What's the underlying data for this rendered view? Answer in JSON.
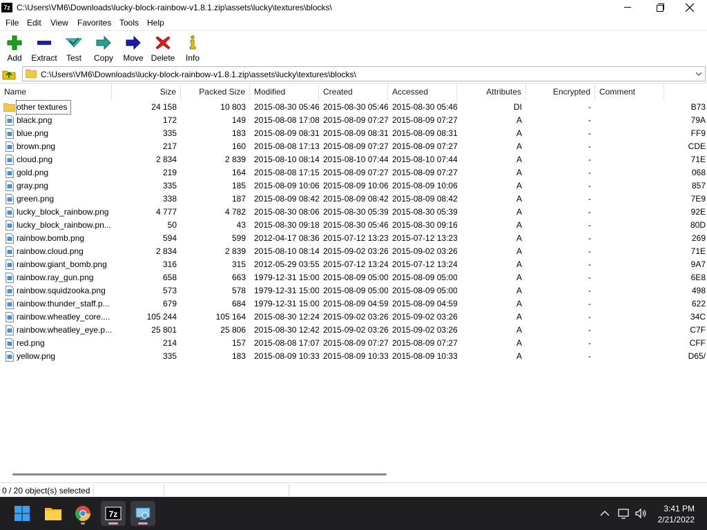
{
  "window": {
    "title": "C:\\Users\\VM6\\Downloads\\lucky-block-rainbow-v1.8.1.zip\\assets\\lucky\\textures\\blocks\\",
    "app_icon": "7z"
  },
  "menu": [
    "File",
    "Edit",
    "View",
    "Favorites",
    "Tools",
    "Help"
  ],
  "toolbar": {
    "add": "Add",
    "extract": "Extract",
    "test": "Test",
    "copy": "Copy",
    "move": "Move",
    "delete": "Delete",
    "info": "Info"
  },
  "address": {
    "path": "C:\\Users\\VM6\\Downloads\\lucky-block-rainbow-v1.8.1.zip\\assets\\lucky\\textures\\blocks\\"
  },
  "columns": {
    "name": "Name",
    "size": "Size",
    "packed": "Packed Size",
    "modified": "Modified",
    "created": "Created",
    "accessed": "Accessed",
    "attributes": "Attributes",
    "encrypted": "Encrypted",
    "comment": "Comment"
  },
  "rows": [
    {
      "name": "other textures",
      "size": "24 158",
      "packed": "10 803",
      "modified": "2015-08-30 05:46",
      "created": "2015-08-30 05:46",
      "accessed": "2015-08-30 05:46",
      "attr": "DI",
      "enc": "-",
      "crc": "B73"
    },
    {
      "name": "black.png",
      "size": "172",
      "packed": "149",
      "modified": "2015-08-08 17:08",
      "created": "2015-08-09 07:27",
      "accessed": "2015-08-09 07:27",
      "attr": "A",
      "enc": "-",
      "crc": "79A"
    },
    {
      "name": "blue.png",
      "size": "335",
      "packed": "183",
      "modified": "2015-08-09 08:31",
      "created": "2015-08-09 08:31",
      "accessed": "2015-08-09 08:31",
      "attr": "A",
      "enc": "-",
      "crc": "FF9"
    },
    {
      "name": "brown.png",
      "size": "217",
      "packed": "160",
      "modified": "2015-08-08 17:13",
      "created": "2015-08-09 07:27",
      "accessed": "2015-08-09 07:27",
      "attr": "A",
      "enc": "-",
      "crc": "CDE"
    },
    {
      "name": "cloud.png",
      "size": "2 834",
      "packed": "2 839",
      "modified": "2015-08-10 08:14",
      "created": "2015-08-10 07:44",
      "accessed": "2015-08-10 07:44",
      "attr": "A",
      "enc": "-",
      "crc": "71E"
    },
    {
      "name": "gold.png",
      "size": "219",
      "packed": "164",
      "modified": "2015-08-08 17:15",
      "created": "2015-08-09 07:27",
      "accessed": "2015-08-09 07:27",
      "attr": "A",
      "enc": "-",
      "crc": "068"
    },
    {
      "name": "gray.png",
      "size": "335",
      "packed": "185",
      "modified": "2015-08-09 10:06",
      "created": "2015-08-09 10:06",
      "accessed": "2015-08-09 10:06",
      "attr": "A",
      "enc": "-",
      "crc": "857"
    },
    {
      "name": "green.png",
      "size": "338",
      "packed": "187",
      "modified": "2015-08-09 08:42",
      "created": "2015-08-09 08:42",
      "accessed": "2015-08-09 08:42",
      "attr": "A",
      "enc": "-",
      "crc": "7E9"
    },
    {
      "name": "lucky_block_rainbow.png",
      "size": "4 777",
      "packed": "4 782",
      "modified": "2015-08-30 08:06",
      "created": "2015-08-30 05:39",
      "accessed": "2015-08-30 05:39",
      "attr": "A",
      "enc": "-",
      "crc": "92E"
    },
    {
      "name": "lucky_block_rainbow.pn...",
      "size": "50",
      "packed": "43",
      "modified": "2015-08-30 09:18",
      "created": "2015-08-30 05:46",
      "accessed": "2015-08-30 09:16",
      "attr": "A",
      "enc": "-",
      "crc": "80D"
    },
    {
      "name": "rainbow.bomb.png",
      "size": "594",
      "packed": "599",
      "modified": "2012-04-17 08:36",
      "created": "2015-07-12 13:23",
      "accessed": "2015-07-12 13:23",
      "attr": "A",
      "enc": "-",
      "crc": "269"
    },
    {
      "name": "rainbow.cloud.png",
      "size": "2 834",
      "packed": "2 839",
      "modified": "2015-08-10 08:14",
      "created": "2015-09-02 03:26",
      "accessed": "2015-09-02 03:26",
      "attr": "A",
      "enc": "-",
      "crc": "71E"
    },
    {
      "name": "rainbow.giant_bomb.png",
      "size": "316",
      "packed": "315",
      "modified": "2012-05-29 03:55",
      "created": "2015-07-12 13:24",
      "accessed": "2015-07-12 13:24",
      "attr": "A",
      "enc": "-",
      "crc": "9A7"
    },
    {
      "name": "rainbow.ray_gun.png",
      "size": "658",
      "packed": "663",
      "modified": "1979-12-31 15:00",
      "created": "2015-08-09 05:00",
      "accessed": "2015-08-09 05:00",
      "attr": "A",
      "enc": "-",
      "crc": "6E8"
    },
    {
      "name": "rainbow.squidzooka.png",
      "size": "573",
      "packed": "578",
      "modified": "1979-12-31 15:00",
      "created": "2015-08-09 05:00",
      "accessed": "2015-08-09 05:00",
      "attr": "A",
      "enc": "-",
      "crc": "498"
    },
    {
      "name": "rainbow.thunder_staff.p...",
      "size": "679",
      "packed": "684",
      "modified": "1979-12-31 15:00",
      "created": "2015-08-09 04:59",
      "accessed": "2015-08-09 04:59",
      "attr": "A",
      "enc": "-",
      "crc": "622"
    },
    {
      "name": "rainbow.wheatley_core....",
      "size": "105 244",
      "packed": "105 164",
      "modified": "2015-08-30 12:24",
      "created": "2015-09-02 03:26",
      "accessed": "2015-09-02 03:26",
      "attr": "A",
      "enc": "-",
      "crc": "34C"
    },
    {
      "name": "rainbow.wheatley_eye.p...",
      "size": "25 801",
      "packed": "25 806",
      "modified": "2015-08-30 12:42",
      "created": "2015-09-02 03:26",
      "accessed": "2015-09-02 03:26",
      "attr": "A",
      "enc": "-",
      "crc": "C7F"
    },
    {
      "name": "red.png",
      "size": "214",
      "packed": "157",
      "modified": "2015-08-08 17:07",
      "created": "2015-08-09 07:27",
      "accessed": "2015-08-09 07:27",
      "attr": "A",
      "enc": "-",
      "crc": "CFF"
    },
    {
      "name": "yellow.png",
      "size": "335",
      "packed": "183",
      "modified": "2015-08-09 10:33",
      "created": "2015-08-09 10:33",
      "accessed": "2015-08-09 10:33",
      "attr": "A",
      "enc": "-",
      "crc": "D65/"
    }
  ],
  "status": {
    "selection": "0 / 20 object(s) selected"
  },
  "taskbar": {
    "icons": [
      "windows-start-icon",
      "file-explorer-icon",
      "chrome-icon",
      "7zip-icon",
      "remote-desktop-icon"
    ],
    "clock": {
      "time": "3:41 PM",
      "date": "2/21/2022"
    }
  },
  "colors": {
    "add_green": "#1aa31a",
    "extract_blue": "#1c1ca8",
    "delete_red": "#e11b1b",
    "taskbar": "#1f1f22"
  }
}
